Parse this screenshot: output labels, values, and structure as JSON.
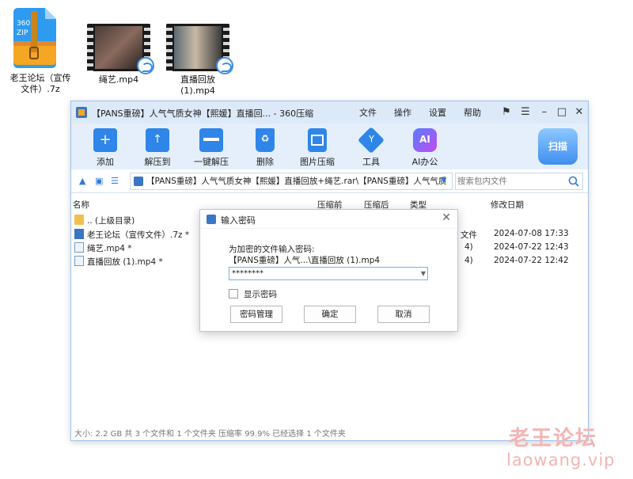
{
  "desktop": {
    "items": [
      {
        "label": "老王论坛（宣传文件）.7z",
        "icon": "360zip-archive-icon"
      },
      {
        "label": "绳艺.mp4",
        "icon": "video-file-icon"
      },
      {
        "label": "直播回放 (1).mp4",
        "icon": "video-file-icon"
      }
    ],
    "zip_badge": "360\nZIP"
  },
  "window": {
    "title": "【PANS重磅】人气气质女神【熙媛】直播回... - 360压缩",
    "menu": [
      "文件",
      "操作",
      "设置",
      "帮助"
    ],
    "toolbar": [
      {
        "label": "添加",
        "icon": "add-icon",
        "color": "#2f86e8"
      },
      {
        "label": "解压到",
        "icon": "extract-to-icon",
        "color": "#2f86e8"
      },
      {
        "label": "一键解压",
        "icon": "one-click-extract-icon",
        "color": "#2f86e8"
      },
      {
        "label": "删除",
        "icon": "delete-icon",
        "color": "#2f86e8"
      },
      {
        "label": "图片压缩",
        "icon": "image-compress-icon",
        "color": "#2f86e8"
      },
      {
        "label": "工具",
        "icon": "tools-icon",
        "color": "#2f86e8"
      },
      {
        "label": "AI办公",
        "icon": "ai-office-icon",
        "color": "#b24cf0"
      }
    ],
    "scan_label": "扫描",
    "address": "【PANS重磅】人气气质女神【熙媛】直播回放+绳艺.rar\\【PANS重磅】人气气质",
    "search_placeholder": "搜索包内文件",
    "columns": [
      "名称",
      "压缩前",
      "压缩后",
      "类型",
      "修改日期"
    ],
    "rows": [
      {
        "name": ".. (上级目录)",
        "type": "",
        "date": ""
      },
      {
        "name": "老王论坛（宣传文件）.7z *",
        "type": "文件",
        "date": "2024-07-08 17:33"
      },
      {
        "name": "绳艺.mp4 *",
        "type": "4)",
        "date": "2024-07-22 12:43"
      },
      {
        "name": "直播回放 (1).mp4 *",
        "type": "4)",
        "date": "2024-07-22 12:42"
      }
    ],
    "status": "大小: 2.2 GB 共 3 个文件和 1 个文件夹 压缩率 99.9% 已经选择 1 个文件夹"
  },
  "dialog": {
    "title": "输入密码",
    "prompt": "为加密的文件输入密码:",
    "file": "【PANS重磅】人气...\\直播回放 (1).mp4",
    "password": "********",
    "show_password": "显示密码",
    "buttons": {
      "manage": "密码管理",
      "ok": "确定",
      "cancel": "取消"
    }
  },
  "watermark": {
    "line1": "老王论坛",
    "line2": "laowang.vip"
  }
}
